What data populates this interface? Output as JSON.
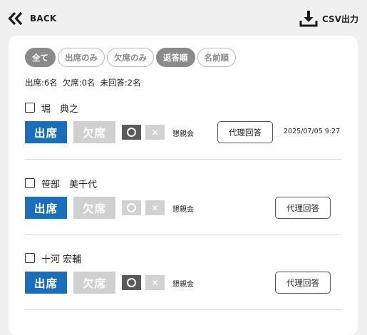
{
  "header": {
    "back_label": "BACK",
    "csv_label": "CSV出力"
  },
  "filters": [
    {
      "label": "全て",
      "active": true
    },
    {
      "label": "出席のみ",
      "active": false
    },
    {
      "label": "欠席のみ",
      "active": false
    },
    {
      "label": "返答順",
      "active": true
    },
    {
      "label": "名前順",
      "active": false
    }
  ],
  "summary": {
    "present": "出席:6名",
    "absent": "欠席:0名",
    "unanswered": "未回答:2名"
  },
  "rows": [
    {
      "name": "堀　典之",
      "present_label": "出席",
      "absent_label": "欠席",
      "circle_on": true,
      "x_label": "✕",
      "group": "懇親会",
      "proxy_label": "代理回答",
      "timestamp": "2025/07/05 9:27"
    },
    {
      "name": "笹部　美千代",
      "present_label": "出席",
      "absent_label": "欠席",
      "circle_on": false,
      "x_label": "✕",
      "group": "懇親会",
      "proxy_label": "代理回答",
      "timestamp": ""
    },
    {
      "name": "十河 宏輔",
      "present_label": "出席",
      "absent_label": "欠席",
      "circle_on": true,
      "x_label": "✕",
      "group": "懇親会",
      "proxy_label": "代理回答",
      "timestamp": ""
    }
  ]
}
